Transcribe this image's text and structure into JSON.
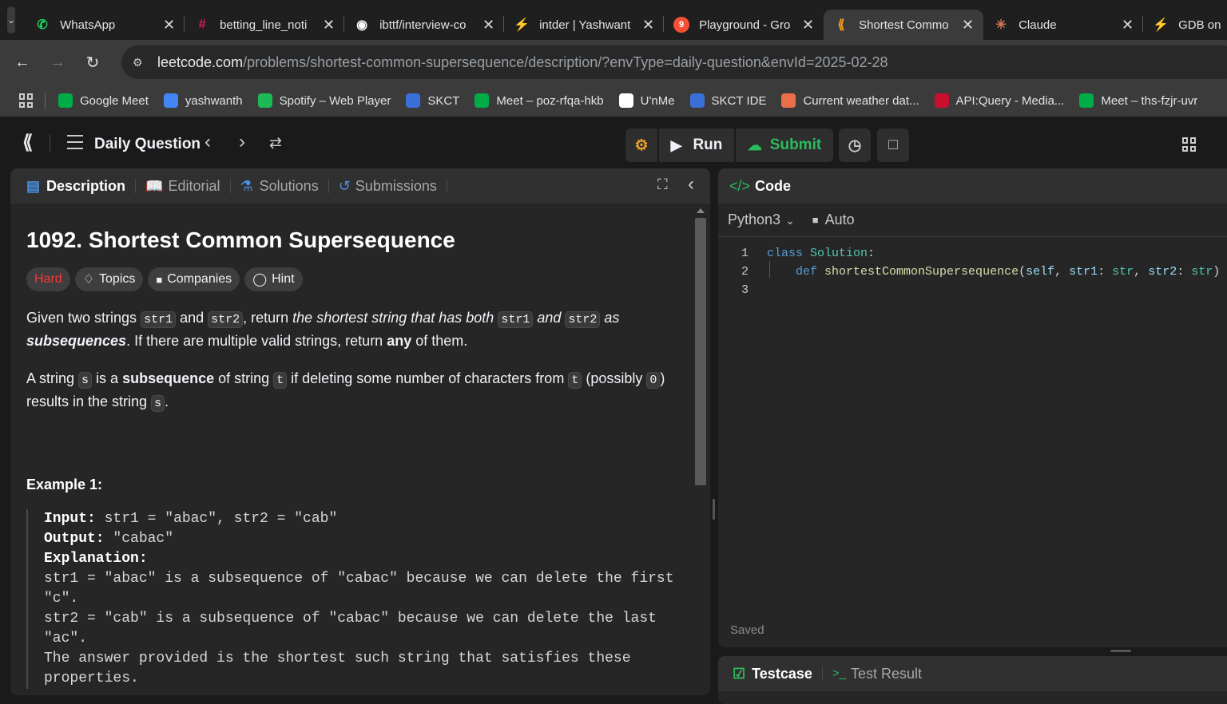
{
  "browser": {
    "tabs": [
      {
        "title": "WhatsApp",
        "icon": "whatsapp-icon",
        "color": "#25d366"
      },
      {
        "title": "betting_line_noti",
        "icon": "slack-icon",
        "color": "#e01e5a"
      },
      {
        "title": "ibttf/interview-co",
        "icon": "github-icon",
        "color": "#ffffff"
      },
      {
        "title": "intder | Yashwant",
        "icon": "bolt-icon",
        "color": "#3ecf8e"
      },
      {
        "title": "Playground - Gro",
        "icon": "groq-icon",
        "color": "#f55036",
        "badge": "9"
      },
      {
        "title": "Shortest Commo",
        "icon": "leetcode-icon",
        "color": "#ffa116",
        "active": true
      },
      {
        "title": "Claude",
        "icon": "claude-icon",
        "color": "#d97757"
      },
      {
        "title": "GDB on",
        "icon": "gdb-icon",
        "color": "#8b5cf6"
      }
    ],
    "url_site": "leetcode.com",
    "url_rest": "/problems/shortest-common-supersequence/description/?envType=daily-question&envId=2025-02-28",
    "bookmarks": [
      {
        "label": "Google Meet",
        "color": "#00ac47"
      },
      {
        "label": "yashwanth",
        "color": "#4285f4"
      },
      {
        "label": "Spotify – Web Player",
        "color": "#1db954"
      },
      {
        "label": "SKCT",
        "color": "#3b6fd8"
      },
      {
        "label": "Meet – poz-rfqa-hkb",
        "color": "#00ac47"
      },
      {
        "label": "U'nMe",
        "color": "#ffffff"
      },
      {
        "label": "SKCT IDE",
        "color": "#3b6fd8"
      },
      {
        "label": "Current weather dat...",
        "color": "#eb6e4b"
      },
      {
        "label": "API:Query - Media...",
        "color": "#c8102e"
      },
      {
        "label": "Meet – ths-fzjr-uvr",
        "color": "#00ac47"
      }
    ]
  },
  "header": {
    "daily": "Daily Question",
    "run": "Run",
    "submit": "Submit"
  },
  "left": {
    "tabs": [
      "Description",
      "Editorial",
      "Solutions",
      "Submissions"
    ],
    "title": "1092. Shortest Common Supersequence",
    "difficulty": "Hard",
    "pills": [
      "Topics",
      "Companies",
      "Hint"
    ],
    "p1": {
      "a": "Given two strings ",
      "c1": "str1",
      "b": " and ",
      "c2": "str2",
      "c": ", return ",
      "d": "the shortest string that has both ",
      "c3": "str1",
      "e": " and ",
      "c4": "str2",
      "f": " as ",
      "g": "subsequences",
      "h": ". If there are multiple valid strings, return ",
      "i": "any",
      "j": " of them."
    },
    "p2": {
      "a": "A string ",
      "c1": "s",
      "b": " is a ",
      "sub": "subsequence",
      "c": " of string ",
      "c2": "t",
      "d": " if deleting some number of characters from ",
      "c3": "t",
      "e": " (possibly ",
      "c4": "0",
      "f": ")",
      "g": "results in the string ",
      "c5": "s",
      "h": "."
    },
    "example_title": "Example 1:",
    "ex": {
      "in_l": "Input:",
      "in_v": " str1 = \"abac\", str2 = \"cab\"",
      "out_l": "Output:",
      "out_v": " \"cabac\"",
      "exp_l": "Explanation:",
      "l1": "str1 = \"abac\" is a subsequence of \"cabac\" because we can delete the first",
      "l2": "\"c\".",
      "l3": "str2 = \"cab\" is a subsequence of \"cabac\" because we can delete the last",
      "l4": "\"ac\".",
      "l5": "The answer provided is the shortest such string that satisfies these",
      "l6": "properties."
    }
  },
  "right": {
    "title": "Code",
    "lang": "Python3",
    "auto": "Auto",
    "lines": [
      "1",
      "2",
      "3"
    ],
    "saved": "Saved",
    "bottom_tabs": [
      "Testcase",
      "Test Result"
    ]
  }
}
